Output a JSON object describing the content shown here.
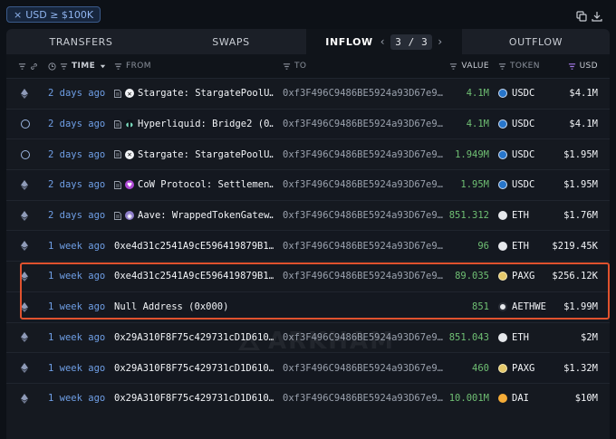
{
  "filter_chip": {
    "close": "×",
    "label": "USD ≥ $100K"
  },
  "top_icons": [
    "copy-icon",
    "download-icon"
  ],
  "tabs": [
    {
      "label": "TRANSFERS",
      "active": false
    },
    {
      "label": "SWAPS",
      "active": false
    },
    {
      "label": "INFLOW",
      "active": true
    },
    {
      "label": "OUTFLOW",
      "active": false
    }
  ],
  "pager": {
    "prev": "‹",
    "current": "3 / 3",
    "next": "›"
  },
  "headers": {
    "time": "TIME",
    "from": "FROM",
    "to": "TO",
    "value": "VALUE",
    "token": "TOKEN",
    "usd": "USD"
  },
  "watermark": "ARKHAM",
  "colors": {
    "accent_blue": "#6f9fe6",
    "value_green": "#6fbf73",
    "highlight_border": "#e0522e",
    "usdc": "#2775ca",
    "paxg": "#e4c86a",
    "dai": "#f5ac37"
  },
  "rows": [
    {
      "chain": "ethereum",
      "time": "2 days ago",
      "from_icon": "doc-icon",
      "from_logo": "stargate",
      "from": "Stargate: StargatePoolU…",
      "to": "0xf3F496C9486BE5924a93D67e9…",
      "value": "4.1M",
      "token_icon": "usdc",
      "token": "USDC",
      "usd": "$4.1M"
    },
    {
      "chain": "hyperliquid",
      "time": "2 days ago",
      "from_icon": "doc-icon",
      "from_logo": "hyperliquid",
      "from": "Hyperliquid: Bridge2 (0…",
      "to": "0xf3F496C9486BE5924a93D67e9…",
      "value": "4.1M",
      "token_icon": "usdc",
      "token": "USDC",
      "usd": "$4.1M"
    },
    {
      "chain": "hyperliquid",
      "time": "2 days ago",
      "from_icon": "doc-icon",
      "from_logo": "stargate",
      "from": "Stargate: StargatePoolU…",
      "to": "0xf3F496C9486BE5924a93D67e9…",
      "value": "1.949M",
      "token_icon": "usdc",
      "token": "USDC",
      "usd": "$1.95M"
    },
    {
      "chain": "ethereum",
      "time": "2 days ago",
      "from_icon": "doc-icon",
      "from_logo": "cow",
      "from": "CoW Protocol: Settlemen…",
      "to": "0xf3F496C9486BE5924a93D67e9…",
      "value": "1.95M",
      "token_icon": "usdc",
      "token": "USDC",
      "usd": "$1.95M"
    },
    {
      "chain": "ethereum",
      "time": "2 days ago",
      "from_icon": "doc-icon",
      "from_logo": "aave",
      "from": "Aave: WrappedTokenGatew…",
      "to": "0xf3F496C9486BE5924a93D67e9…",
      "value": "851.312",
      "token_icon": "eth",
      "token": "ETH",
      "usd": "$1.76M"
    },
    {
      "chain": "ethereum",
      "time": "1 week ago",
      "from_icon": "",
      "from_logo": "",
      "from": "0xe4d31c2541A9cE596419879B1…",
      "to": "0xf3F496C9486BE5924a93D67e9…",
      "value": "96",
      "token_icon": "eth",
      "token": "ETH",
      "usd": "$219.45K"
    },
    {
      "chain": "ethereum",
      "time": "1 week ago",
      "from_icon": "",
      "from_logo": "",
      "from": "0xe4d31c2541A9cE596419879B1…",
      "to": "0xf3F496C9486BE5924a93D67e9…",
      "value": "89.035",
      "token_icon": "paxg",
      "token": "PAXG",
      "usd": "$256.12K"
    },
    {
      "chain": "ethereum",
      "time": "1 week ago",
      "from_icon": "",
      "from_logo": "",
      "from": "Null Address (0x000)",
      "to": "",
      "value": "851",
      "token_icon": "aethwe",
      "token": "AETHWE",
      "usd": "$1.99M"
    },
    {
      "chain": "ethereum",
      "time": "1 week ago",
      "from_icon": "",
      "from_logo": "",
      "from": "0x29A310F8F75c429731cD1D610…",
      "to": "0xf3F496C9486BE5924a93D67e9…",
      "value": "851.043",
      "token_icon": "eth",
      "token": "ETH",
      "usd": "$2M"
    },
    {
      "chain": "ethereum",
      "time": "1 week ago",
      "from_icon": "",
      "from_logo": "",
      "from": "0x29A310F8F75c429731cD1D610…",
      "to": "0xf3F496C9486BE5924a93D67e9…",
      "value": "460",
      "token_icon": "paxg",
      "token": "PAXG",
      "usd": "$1.32M"
    },
    {
      "chain": "ethereum",
      "time": "1 week ago",
      "from_icon": "",
      "from_logo": "",
      "from": "0x29A310F8F75c429731cD1D610…",
      "to": "0xf3F496C9486BE5924a93D67e9…",
      "value": "10.001M",
      "token_icon": "dai",
      "token": "DAI",
      "usd": "$10M"
    }
  ]
}
